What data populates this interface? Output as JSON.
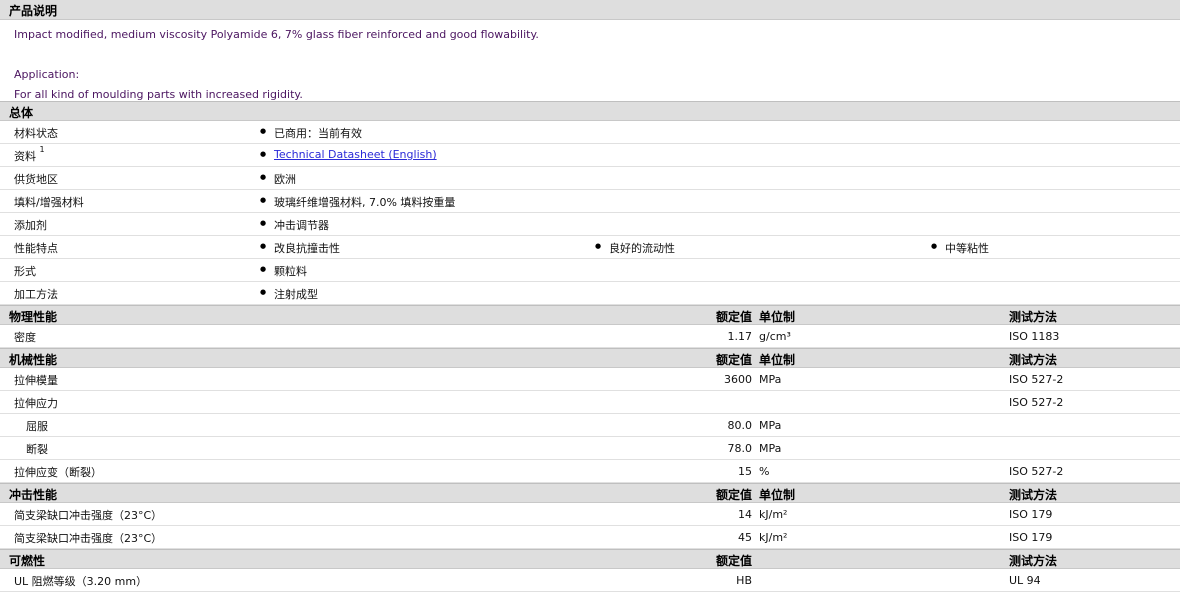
{
  "desc_section": {
    "title": "产品说明",
    "lines": [
      "Impact modified, medium viscosity Polyamide 6, 7% glass fiber reinforced and good flowability.",
      "",
      "Application:",
      "For all kind of moulding parts with increased rigidity."
    ]
  },
  "general": {
    "title": "总体",
    "rows": [
      {
        "label": "材料状态",
        "values": [
          "已商用：当前有效"
        ]
      },
      {
        "label": "资料",
        "sup": "1",
        "values": [
          "Technical Datasheet (English)"
        ]
      },
      {
        "label": "供货地区",
        "values": [
          "欧洲"
        ]
      },
      {
        "label": "填料/增强材料",
        "values": [
          "玻璃纤维增强材料, 7.0% 填料按重量"
        ]
      },
      {
        "label": "添加剂",
        "values": [
          "冲击调节器"
        ]
      },
      {
        "label": "性能特点",
        "values": [
          "改良抗撞击性",
          "良好的流动性",
          "中等粘性"
        ]
      },
      {
        "label": "形式",
        "values": [
          "颗粒料"
        ]
      },
      {
        "label": "加工方法",
        "values": [
          "注射成型"
        ]
      }
    ]
  },
  "headers": {
    "nominal": "额定值",
    "unit": "单位制",
    "method": "测试方法"
  },
  "physical": {
    "title": "物理性能",
    "rows": [
      {
        "label": "密度",
        "value": "1.17",
        "unit": "g/cm³",
        "method": "ISO 1183"
      }
    ]
  },
  "mechanical": {
    "title": "机械性能",
    "rows": [
      {
        "label": "拉伸模量",
        "value": "3600",
        "unit": "MPa",
        "method": "ISO 527-2"
      },
      {
        "label": "拉伸应力",
        "value": "",
        "unit": "",
        "method": "ISO 527-2"
      },
      {
        "label": "屈服",
        "value": "80.0",
        "unit": "MPa",
        "method": ""
      },
      {
        "label": "断裂",
        "value": "78.0",
        "unit": "MPa",
        "method": ""
      },
      {
        "label": "拉伸应变（断裂）",
        "value": "15",
        "unit": "%",
        "method": "ISO 527-2"
      }
    ]
  },
  "impact": {
    "title": "冲击性能",
    "rows": [
      {
        "label": "简支梁缺口冲击强度（23°C）",
        "value": "14",
        "unit": "kJ/m²",
        "method": "ISO 179"
      },
      {
        "label": "简支梁缺口冲击强度（23°C）",
        "value": "45",
        "unit": "kJ/m²",
        "method": "ISO 179"
      }
    ]
  },
  "flammability": {
    "title": "可燃性",
    "rows": [
      {
        "label": "UL 阻燃等级（3.20 mm）",
        "value": "HB",
        "unit": "",
        "method": "UL 94"
      }
    ]
  }
}
